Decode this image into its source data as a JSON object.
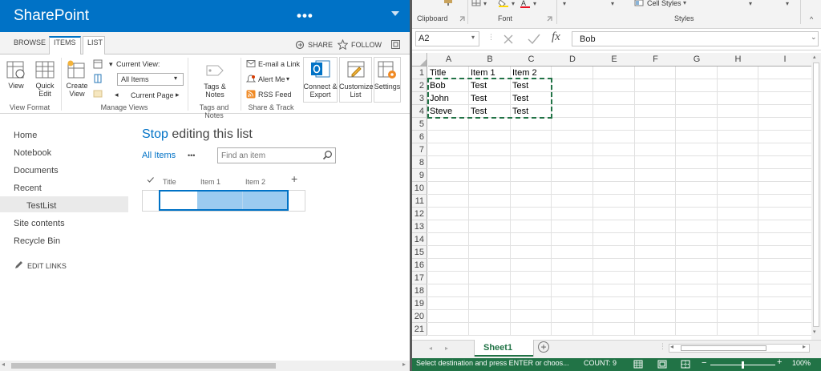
{
  "sharepoint": {
    "brand": "SharePoint",
    "more": "•••",
    "tabs": [
      "BROWSE",
      "ITEMS",
      "LIST"
    ],
    "share_label": "SHARE",
    "follow_label": "FOLLOW",
    "ribbon": {
      "view": "View",
      "quick_edit": "Quick Edit",
      "create_view": "Create View",
      "current_view_label": "Current View:",
      "current_view_value": "All Items",
      "current_page": "Current Page",
      "tags_notes": "Tags & Notes",
      "email_link": "E-mail a Link",
      "alert_me": "Alert Me",
      "rss_feed": "RSS Feed",
      "connect_export": "Connect & Export",
      "customize_list": "Customize List",
      "settings": "Settings",
      "groups": [
        "View Format",
        "Manage Views",
        "Tags and Notes",
        "Share & Track"
      ]
    },
    "nav": [
      "Home",
      "Notebook",
      "Documents",
      "Recent",
      "TestList",
      "Site contents",
      "Recycle Bin"
    ],
    "edit_links": "EDIT LINKS",
    "page_title_strong": "Stop",
    "page_title_rest": " editing this list",
    "all_items": "All Items",
    "ellipsis": "•••",
    "search_placeholder": "Find an item",
    "columns": [
      "Title",
      "Item 1",
      "Item 2"
    ],
    "add_column": "+"
  },
  "excel": {
    "ribbon_groups": [
      "Clipboard",
      "Font",
      "Styles"
    ],
    "cell_styles": "Cell Styles",
    "name_box": "A2",
    "formula_value": "Bob",
    "col_headers": [
      "A",
      "B",
      "C",
      "D",
      "E",
      "F",
      "G",
      "H",
      "I"
    ],
    "rows": [
      [
        "Title",
        "Item 1",
        "Item 2"
      ],
      [
        "Bob",
        "Test",
        "Test"
      ],
      [
        "John",
        "Test",
        "Test"
      ],
      [
        "Steve",
        "Test",
        "Test"
      ]
    ],
    "row_numbers": [
      "1",
      "2",
      "3",
      "4",
      "5",
      "6",
      "7",
      "8",
      "9",
      "10",
      "11",
      "12",
      "13",
      "14",
      "15",
      "16",
      "17",
      "18",
      "19",
      "20",
      "21"
    ],
    "sheet_tab": "Sheet1",
    "add_sheet": "+",
    "status_text": "Select destination and press ENTER or choos...",
    "count": "COUNT: 9",
    "zoom": "100%",
    "accent": "#217346"
  }
}
